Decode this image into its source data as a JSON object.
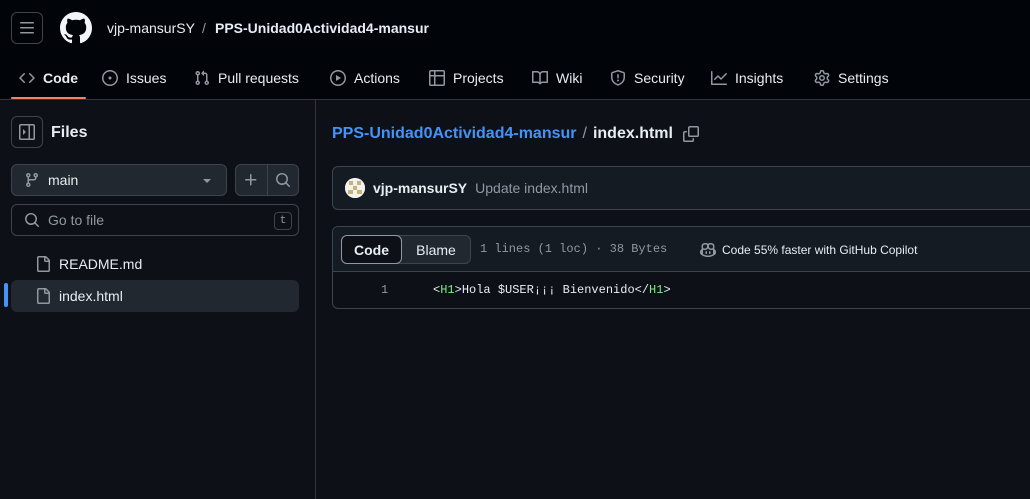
{
  "header": {
    "owner": "vjp-mansurSY",
    "separator": "/",
    "repo": "PPS-Unidad0Actividad4-mansur"
  },
  "nav": {
    "code": "Code",
    "issues": "Issues",
    "pulls": "Pull requests",
    "actions": "Actions",
    "projects": "Projects",
    "wiki": "Wiki",
    "security": "Security",
    "insights": "Insights",
    "settings": "Settings",
    "active_tab": "Code"
  },
  "sidebar": {
    "title": "Files",
    "branch": "main",
    "go_to_file_placeholder": "Go to file",
    "shortcut": "t",
    "files": [
      {
        "name": "README.md",
        "selected": false
      },
      {
        "name": "index.html",
        "selected": true
      }
    ]
  },
  "breadcrumb": {
    "repo": "PPS-Unidad0Actividad4-mansur",
    "separator": "/",
    "file": "index.html"
  },
  "commit": {
    "author": "vjp-mansurSY",
    "message": "Update index.html"
  },
  "file_view": {
    "code_label": "Code",
    "blame_label": "Blame",
    "meta": "1 lines (1 loc) · 38 Bytes",
    "copilot": "Code 55% faster with GitHub Copilot",
    "lines": [
      {
        "number": "1",
        "open_lt": "<",
        "open_tag": "H1",
        "open_gt": ">",
        "text": "Hola $USER¡¡¡ Bienvenido",
        "close_lt": "</",
        "close_tag": "H1",
        "close_gt": ">"
      }
    ]
  },
  "colors": {
    "accent_link": "#4493f8",
    "tab_underline": "#f78166",
    "tag": "#7ee787",
    "background": "#0d1117"
  }
}
